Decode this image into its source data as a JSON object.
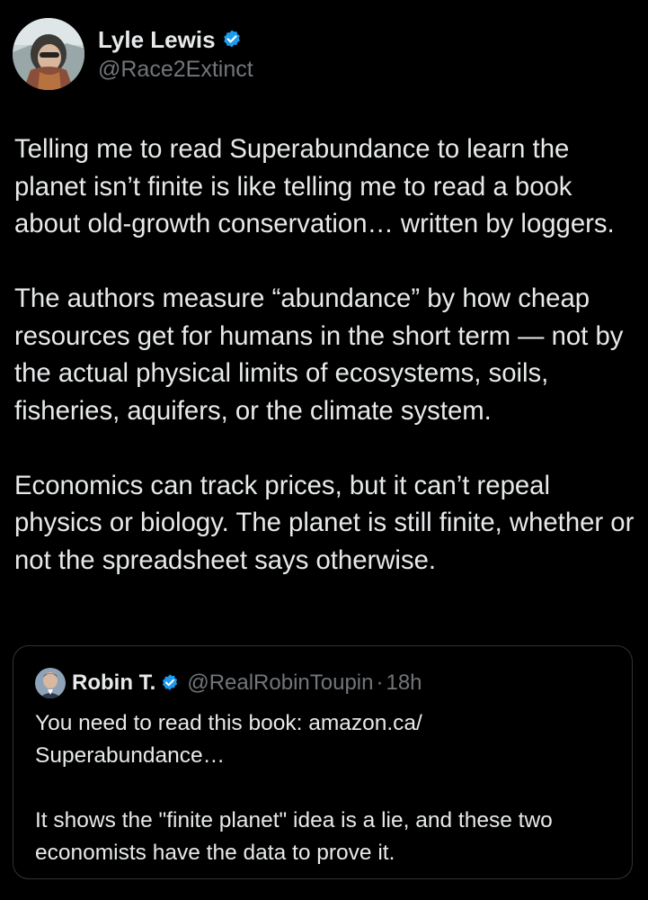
{
  "author": {
    "name": "Lyle Lewis",
    "handle": "@Race2Extinct",
    "avatar": "profile-photo",
    "verified_icon": "verified-badge-icon"
  },
  "tweet": {
    "paragraphs": [
      "Telling me to read Superabundance to learn the planet isn’t finite is like telling me to read a book about old-growth conservation… written by loggers.",
      "The authors measure “abundance” by how cheap resources get for humans in the short term — not by the actual physical limits of ecosystems, soils, fisheries, aquifers, or the climate system.",
      "Economics can track prices, but it can’t repeal physics or biology. The planet is still finite, whether or not the spreadsheet says otherwise."
    ]
  },
  "quote": {
    "name": "Robin T.",
    "handle": "@RealRobinToupin",
    "separator": "·",
    "time": "18h",
    "paragraphs": [
      "You need to read this book:  amazon.ca/\nSuperabundance…",
      "It shows the \"finite planet\" idea is a lie, and these two economists have the data to prove it."
    ]
  },
  "colors": {
    "background": "#000000",
    "text_primary": "#e7e9ea",
    "text_secondary": "#71767b",
    "verified_blue": "#1d9bf0",
    "border": "#2f3336"
  }
}
